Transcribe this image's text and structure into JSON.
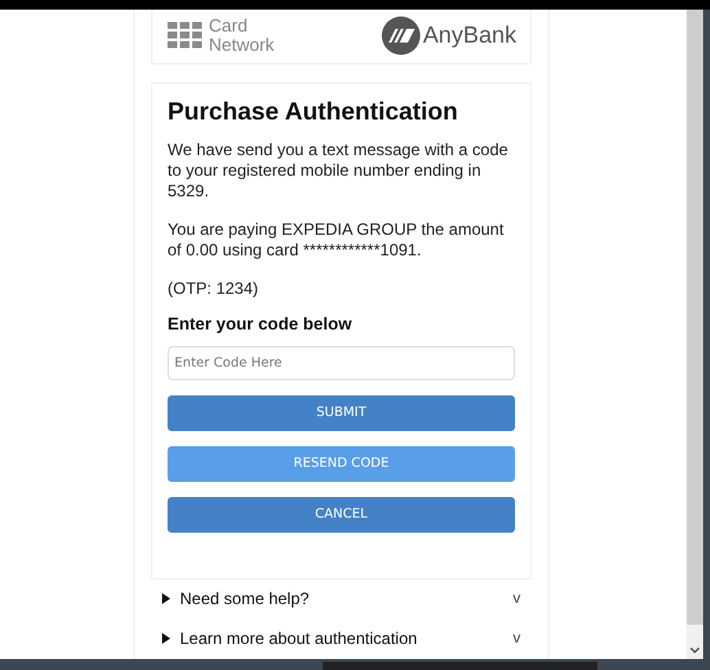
{
  "header": {
    "card_network": {
      "line_1": "Card",
      "line_2": "Network"
    },
    "bank_name": "AnyBank"
  },
  "title": "Purchase Authentication",
  "paragraphs": [
    "We have send you a text message with a code to your registered mobile number ending in 5329.",
    "You are paying EXPEDIA GROUP the amount of 0.00 using card ************1091.",
    "(OTP: 1234)"
  ],
  "code_label": "Enter your code below",
  "code_field": {
    "placeholder": "Enter Code Here"
  },
  "buttons": [
    {
      "label": "SUBMIT",
      "kind": "primary"
    },
    {
      "label": "RESEND CODE",
      "kind": "secondary"
    },
    {
      "label": "CANCEL",
      "kind": "primary"
    }
  ],
  "sections": [
    {
      "label": "Need some help?",
      "expanded": false,
      "toggle": "v"
    },
    {
      "label": "Learn more about authentication",
      "expanded": false,
      "toggle": "v"
    }
  ]
}
